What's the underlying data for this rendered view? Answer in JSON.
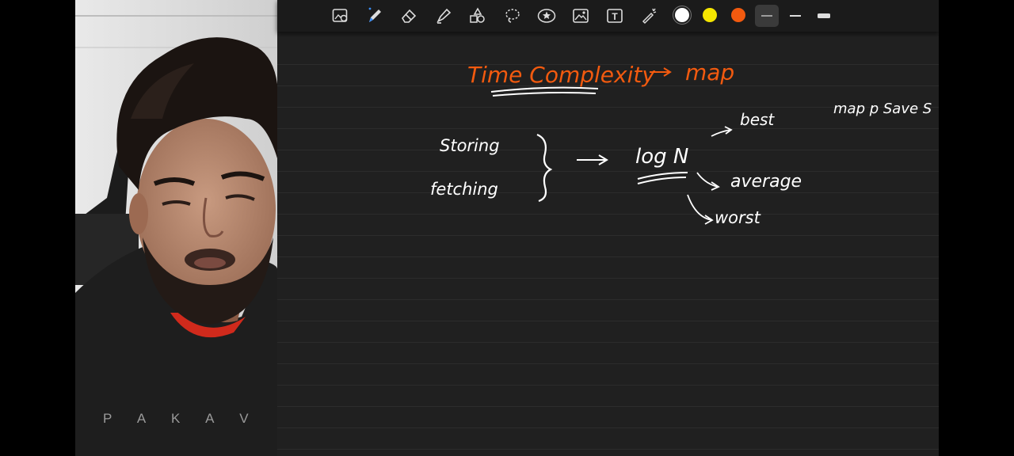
{
  "webcam": {
    "hoodie_text": "P A   K A V"
  },
  "toolbar": {
    "tools": [
      {
        "name": "lasso-view-tool",
        "icon": "image-search-icon"
      },
      {
        "name": "pen-tool",
        "icon": "pen-icon"
      },
      {
        "name": "eraser-tool",
        "icon": "eraser-icon"
      },
      {
        "name": "highlighter-tool",
        "icon": "highlighter-icon"
      },
      {
        "name": "shapes-tool",
        "icon": "shapes-icon"
      },
      {
        "name": "lasso-tool",
        "icon": "lasso-icon"
      },
      {
        "name": "sticker-tool",
        "icon": "star-sticker-icon"
      },
      {
        "name": "image-tool",
        "icon": "image-icon"
      },
      {
        "name": "text-tool",
        "icon": "text-box-icon"
      },
      {
        "name": "laser-pointer-tool",
        "icon": "laser-pointer-icon"
      }
    ],
    "colors": [
      {
        "name": "white",
        "hex": "#ffffff"
      },
      {
        "name": "yellow",
        "hex": "#f5e600"
      },
      {
        "name": "orange",
        "hex": "#f25a0f"
      }
    ],
    "stroke_sizes": [
      "thin",
      "medium",
      "thick"
    ],
    "text_tool_glyph": "T"
  },
  "note": {
    "title": "Time Complexity",
    "title_arrow_target": "map",
    "operations": [
      "Storing",
      "fetching"
    ],
    "complexity": "log N",
    "cases": [
      "best",
      "average",
      "worst"
    ],
    "side_note": "map p Save S",
    "ink_colors": {
      "title": "#f25a0f",
      "body": "#ffffff"
    }
  }
}
